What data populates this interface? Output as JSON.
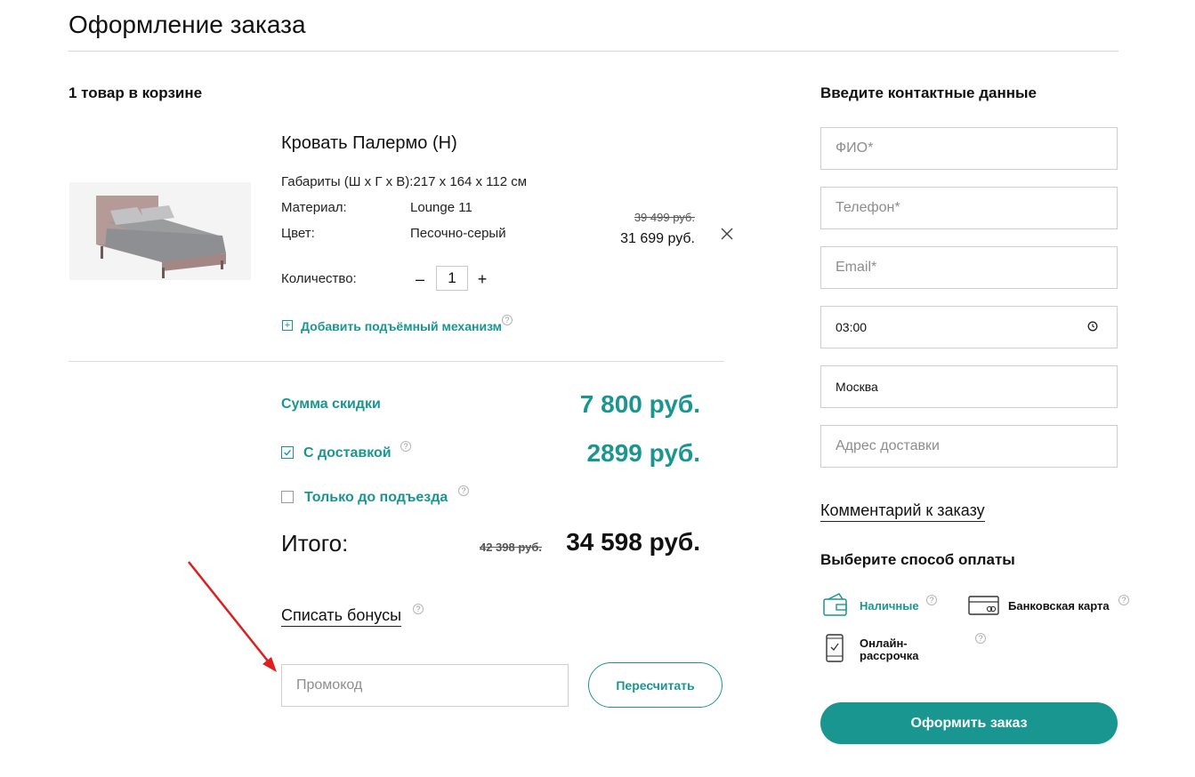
{
  "page": {
    "title": "Оформление заказа"
  },
  "cart": {
    "count_label": "1 товар в корзине",
    "item": {
      "name": "Кровать Палермо (Н)",
      "dimensions": "Габариты (Ш х Г х В):217 х 164 х 112 см",
      "material_label": "Материал:",
      "material_value": "Lounge 11",
      "color_label": "Цвет:",
      "color_value": "Песочно-серый",
      "old_price": "39 499 руб.",
      "price": "31 699 руб.",
      "quantity_label": "Количество:",
      "quantity": "1",
      "minus_symbol": "–",
      "plus_symbol": "+",
      "addon_label": "Добавить подъёмный механизм",
      "addon_symbol": "+"
    }
  },
  "summary": {
    "discount_label": "Сумма скидки",
    "discount_value": "7 800 руб.",
    "delivery_label": "С доставкой",
    "delivery_value": "2899 руб.",
    "delivery_checked": true,
    "entrance_label": "Только до подъезда",
    "entrance_checked": false,
    "total_label": "Итого:",
    "total_old": "42 398 руб.",
    "total_value": "34 598 руб.",
    "help_symbol": "?"
  },
  "promo": {
    "bonus_link": "Списать бонусы",
    "placeholder": "Промокод",
    "recalc_label": "Пересчитать"
  },
  "contact": {
    "title": "Введите контактные данные",
    "name_placeholder": "ФИО*",
    "phone_placeholder": "Телефон*",
    "email_placeholder": "Email*",
    "time_value": "03:00",
    "city_value": "Москва",
    "address_placeholder": "Адрес доставки",
    "comment_link": "Комментарий к заказу"
  },
  "payment": {
    "title": "Выберите способ оплаты",
    "options": [
      {
        "label": "Наличные",
        "icon": "wallet-icon",
        "selected": true
      },
      {
        "label": "Банковская карта",
        "icon": "credit-card-icon",
        "selected": false
      },
      {
        "label": "Онлайн-\nрассрочка",
        "icon": "phone-installment-icon",
        "selected": false
      }
    ]
  },
  "submit_label": "Оформить заказ",
  "colors": {
    "accent": "#1a9690",
    "annotation_arrow": "#dd1f1f"
  }
}
